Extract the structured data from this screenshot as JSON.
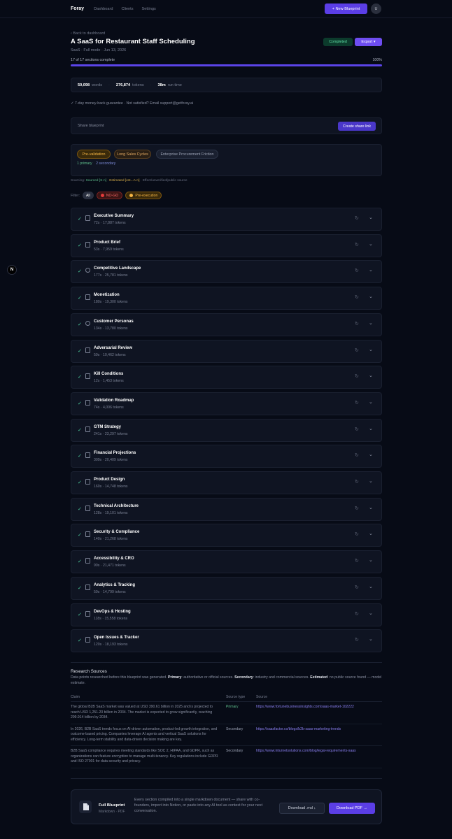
{
  "nav": {
    "brand": "Foray",
    "links": [
      "Dashboard",
      "Clients",
      "Settings"
    ],
    "new_blueprint": "+ New Blueprint",
    "avatar": "U"
  },
  "floating_badge": "N",
  "header": {
    "back": "‹ Back to dashboard",
    "title": "A SaaS for Restaurant Staff Scheduling",
    "subtitle": "SaaS · Full mode · Jun 13, 2026",
    "status": "Completed",
    "export": "Export ▾",
    "progress_text": "17 of 17 sections complete",
    "progress_pct": "100%",
    "progress_value": 1.0
  },
  "stats": {
    "words_value": "50,098",
    "words_label": "words",
    "tokens_value": "276,874",
    "tokens_label": "tokens",
    "runtime_value": "38m",
    "runtime_label": "run time"
  },
  "guarantee": "✓ 7-day money-back guarantee · Not satisfied? Email support@getforay.ai",
  "share": {
    "label": "Share blueprint",
    "button": "Create share link"
  },
  "tags": {
    "items": [
      "Pre-validation",
      "Long Sales Cycles",
      "Enterprise Procurement Friction"
    ],
    "primary": "1 primary",
    "secondary": "2 secondary"
  },
  "legend": {
    "prefix": "Sourcing:",
    "sourced": "Sourced [S-n]",
    "estimated": "Estimated [est...A-n]",
    "suffix": "Effect/unverified/public source"
  },
  "filters": {
    "label": "Filter:",
    "all": "All",
    "nogo": "NO-GO",
    "pre": "Pre-execution"
  },
  "sections": [
    {
      "name": "Executive Summary",
      "meta": "72s · 17,887 tokens"
    },
    {
      "name": "Product Brief",
      "meta": "53s · 7,959 tokens"
    },
    {
      "name": "Competitive Landscape",
      "meta": "177s · 25,781 tokens"
    },
    {
      "name": "Monetization",
      "meta": "180s · 19,300 tokens"
    },
    {
      "name": "Customer Personas",
      "meta": "134s · 13,780 tokens"
    },
    {
      "name": "Adversarial Review",
      "meta": "59s · 10,462 tokens"
    },
    {
      "name": "Kill Conditions",
      "meta": "12s · 1,453 tokens"
    },
    {
      "name": "Validation Roadmap",
      "meta": "74s · 4,006 tokens"
    },
    {
      "name": "GTM Strategy",
      "meta": "241s · 23,297 tokens"
    },
    {
      "name": "Financial Projections",
      "meta": "309s · 20,409 tokens"
    },
    {
      "name": "Product Design",
      "meta": "160s · 14,748 tokens"
    },
    {
      "name": "Technical Architecture",
      "meta": "128s · 19,101 tokens"
    },
    {
      "name": "Security & Compliance",
      "meta": "140s · 21,268 tokens"
    },
    {
      "name": "Accessibility & CRO",
      "meta": "90s · 21,471 tokens"
    },
    {
      "name": "Analytics & Tracking",
      "meta": "59s · 14,799 tokens"
    },
    {
      "name": "DevOps & Hosting",
      "meta": "118s · 15,558 tokens"
    },
    {
      "name": "Open Issues & Tracker",
      "meta": "120s · 18,193 tokens"
    }
  ],
  "research": {
    "title": "Research Sources",
    "desc_intro": "Data points researched before this blueprint was generated.",
    "desc_primary": "Primary",
    "desc_primary_text": ": authoritative or official sources.",
    "desc_secondary": "Secondary",
    "desc_secondary_text": ": industry and commercial sources.",
    "desc_estimated": "Estimated",
    "desc_estimated_text": ": no public source found — model estimate.",
    "headers": [
      "Claim",
      "Source type",
      "Source"
    ],
    "rows": [
      {
        "claim": "The global B2B SaaS market was valued at USD 390.61 billion in 2025 and is projected to reach USD 1,251.20 billion in 2034. The market is expected to grow significantly, reaching 299.914 billion by 2034.",
        "type": "Primary",
        "source": "https://www.fortunebusinessinsights.com/saas-market-102222"
      },
      {
        "claim": "In 2026, B2B SaaS trends focus on AI-driven automation, product-led growth integration, and outcome-based pricing. Companies leverage AI agents and vertical SaaS solutions for efficiency. Long-term stability and data-driven decision making are key.",
        "type": "Secondary",
        "source": "https://saasfactor.co/blogs/b2b-saas-marketing-trends"
      },
      {
        "claim": "B2B SaaS compliance requires meeting standards like SOC 2, HIPAA, and GDPR, such as organizations can feature encryption to manage multi-tenancy. Key regulations include GDPR and ISO 27001 for data security and privacy.",
        "type": "Secondary",
        "source": "https://www.inturnetsolutions.com/blog/legal-requirements-saas"
      }
    ]
  },
  "footer": {
    "title": "Full Blueprint",
    "subtitle": "Markdown · PDF",
    "text": "Every section compiled into a single markdown document — share with co-founders, import into Notion, or paste into any AI tool as context for your next conversation.",
    "download_md": "Download .md ↓",
    "download_pdf": "Download PDF →"
  }
}
